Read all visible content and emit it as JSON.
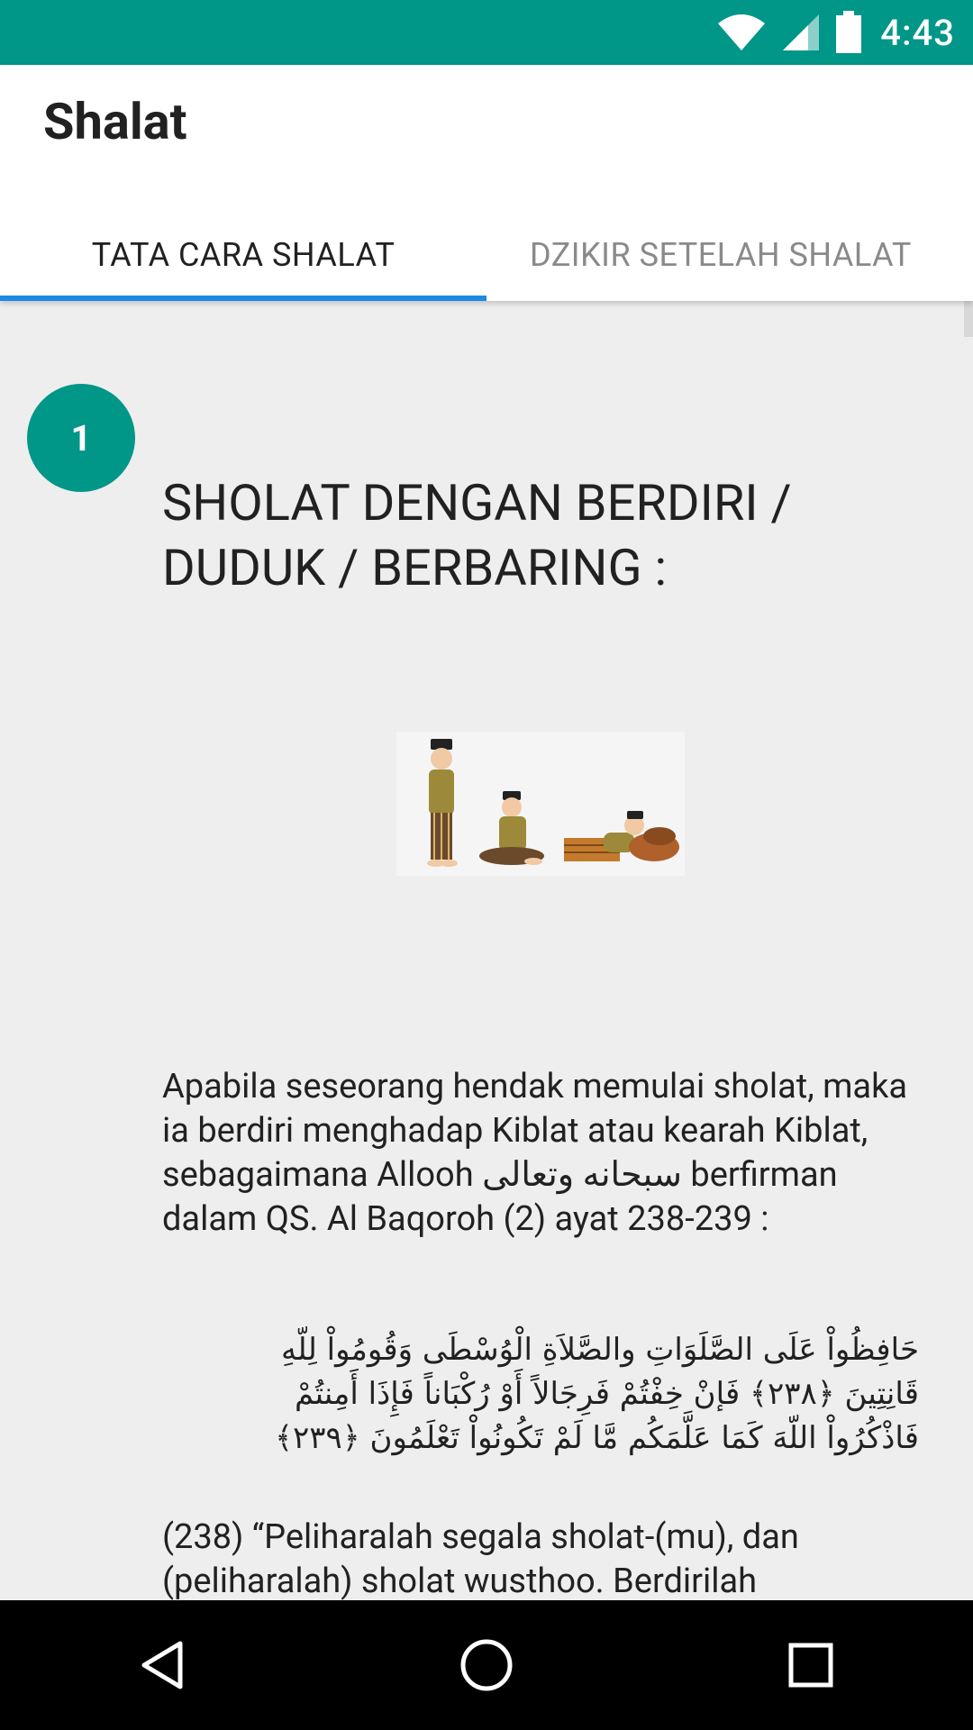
{
  "status_bar": {
    "time": "4:43",
    "icons": [
      "wifi-icon",
      "cell-signal-icon",
      "battery-icon"
    ]
  },
  "app_bar": {
    "title": "Shalat",
    "tabs": [
      {
        "label": "TATA CARA SHALAT",
        "selected": true
      },
      {
        "label": "DZIKIR SETELAH SHALAT",
        "selected": false
      }
    ]
  },
  "step": {
    "number": "1",
    "title": "SHOLAT DENGAN BERDIRI / DUDUK / BERBARING :",
    "paragraph": "Apabila seseorang hendak memulai sholat, maka ia berdiri menghadap Kiblat atau kearah Kiblat, sebagaimana Allooh سبحانه وتعالى berfirman dalam QS. Al Baqoroh (2) ayat 238-239 :",
    "arabic": "حَافِظُواْ عَلَى الصَّلَوَاتِ والصَّلاَةِ الْوُسْطَى وَقُومُواْ لِلّهِ قَانِتِينَ ﴿٢٣٨﴾ فَإنْ خِفْتُمْ فَرِجَالاً أَوْ رُكْبَاناً فَإِذَا أَمِنتُمْ فَاذْكُرُواْ اللّهَ كَمَا عَلَّمَكُم مَّا لَمْ تَكُونُواْ تَعْلَمُونَ ﴿٢٣٩﴾",
    "translation": "(238) “Peliharalah segala sholat-(mu), dan (peliharalah) sholat wusthoo. Berdirilah"
  },
  "colors": {
    "primary": "#009688",
    "tab_indicator": "#1e88e5",
    "background": "#eeeeee"
  },
  "nav_bar": {
    "buttons": [
      "back-icon",
      "home-icon",
      "recents-icon"
    ]
  }
}
